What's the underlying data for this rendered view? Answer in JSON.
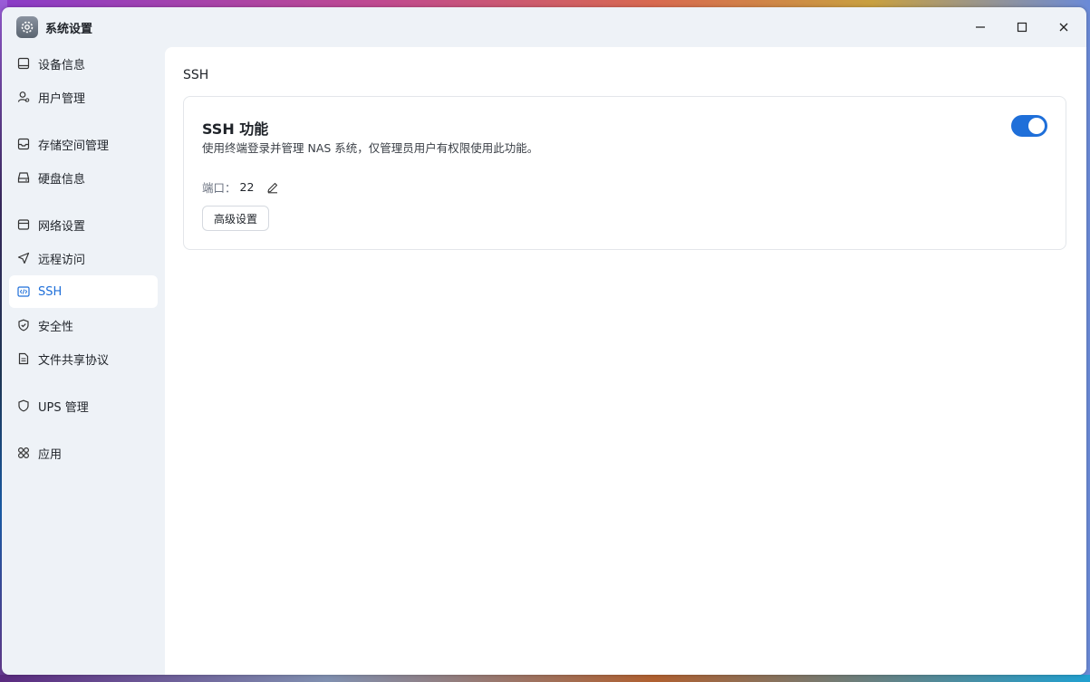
{
  "window": {
    "title": "系统设置",
    "app_icon": "gear-icon"
  },
  "titlebar_controls": {
    "minimize_icon": "minimize-icon",
    "maximize_icon": "maximize-icon",
    "close_icon": "close-icon"
  },
  "sidebar": {
    "groups": [
      [
        {
          "label": "设备信息",
          "icon": "device-icon"
        },
        {
          "label": "用户管理",
          "icon": "user-icon"
        }
      ],
      [
        {
          "label": "存储空间管理",
          "icon": "storage-icon"
        },
        {
          "label": "硬盘信息",
          "icon": "disk-icon"
        }
      ],
      [
        {
          "label": "网络设置",
          "icon": "network-icon"
        },
        {
          "label": "远程访问",
          "icon": "remote-icon"
        },
        {
          "label": "SSH",
          "icon": "code-icon",
          "active": true
        },
        {
          "label": "安全性",
          "icon": "shield-check-icon"
        },
        {
          "label": "文件共享协议",
          "icon": "document-icon"
        }
      ],
      [
        {
          "label": "UPS 管理",
          "icon": "shield-icon"
        }
      ],
      [
        {
          "label": "应用",
          "icon": "apps-icon"
        }
      ]
    ]
  },
  "main": {
    "page_title": "SSH",
    "card": {
      "title": "SSH 功能",
      "description": "使用终端登录并管理 NAS 系统，仅管理员用户有权限使用此功能。",
      "port_label": "端口：",
      "port_value": "22",
      "advanced_button": "高级设置",
      "toggle_on": true
    }
  },
  "colors": {
    "accent": "#1f6fd9",
    "sidebar_bg": "#eef2f7",
    "main_bg": "#ffffff"
  }
}
